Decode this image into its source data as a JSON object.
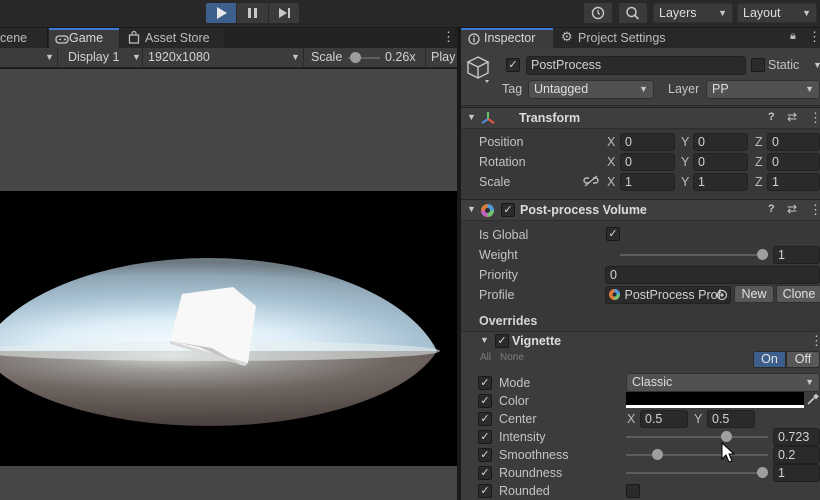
{
  "toolbar": {
    "play_icon": "play-icon",
    "pause_icon": "pause-icon",
    "step_icon": "step-icon",
    "history_icon": "history-icon",
    "search_icon": "search-icon",
    "layers_label": "Layers",
    "layout_label": "Layout"
  },
  "game_view": {
    "tabs": [
      "cene",
      "Game",
      "Asset Store"
    ],
    "display": "Display 1",
    "resolution": "1920x1080",
    "scale_label": "Scale",
    "scale_value": "0.26x",
    "scale_level": 0.1,
    "play_label": "Play"
  },
  "inspector": {
    "tab_inspector": "Inspector",
    "tab_project_settings": "Project Settings",
    "object_name": "PostProcess",
    "static_label": "Static",
    "tag_label": "Tag",
    "tag_value": "Untagged",
    "layer_label": "Layer",
    "layer_value": "PP",
    "transform": {
      "title": "Transform",
      "position_label": "Position",
      "rotation_label": "Rotation",
      "scale_label": "Scale",
      "position": [
        "0",
        "0",
        "0"
      ],
      "rotation": [
        "0",
        "0",
        "0"
      ],
      "scale": [
        "1",
        "1",
        "1"
      ],
      "axes": [
        "X",
        "Y",
        "Z"
      ]
    },
    "ppv": {
      "title": "Post-process Volume",
      "is_global_label": "Is Global",
      "weight_label": "Weight",
      "weight_value": "1",
      "weight_level": 1.0,
      "priority_label": "Priority",
      "priority_value": "0",
      "profile_label": "Profile",
      "profile_value": "PostProcess Prof",
      "new_label": "New",
      "clone_label": "Clone",
      "overrides_label": "Overrides",
      "vignette_label": "Vignette",
      "all_label": "All",
      "none_label": "None",
      "on_label": "On",
      "off_label": "Off",
      "mode_label": "Mode",
      "mode_value": "Classic",
      "color_label": "Color",
      "center_label": "Center",
      "center_x": "0.5",
      "center_y": "0.5",
      "intensity_label": "Intensity",
      "intensity_value": "0.723",
      "intensity_level": 0.723,
      "smoothness_label": "Smoothness",
      "smoothness_value": "0.2",
      "smoothness_level": 0.2,
      "roundness_label": "Roundness",
      "roundness_value": "1",
      "roundness_level": 1.0,
      "rounded_label": "Rounded"
    }
  },
  "colors": {
    "accent": "#3d5f8c",
    "panel": "#383838",
    "toolbar": "#282828",
    "field": "#2a2a2a"
  }
}
